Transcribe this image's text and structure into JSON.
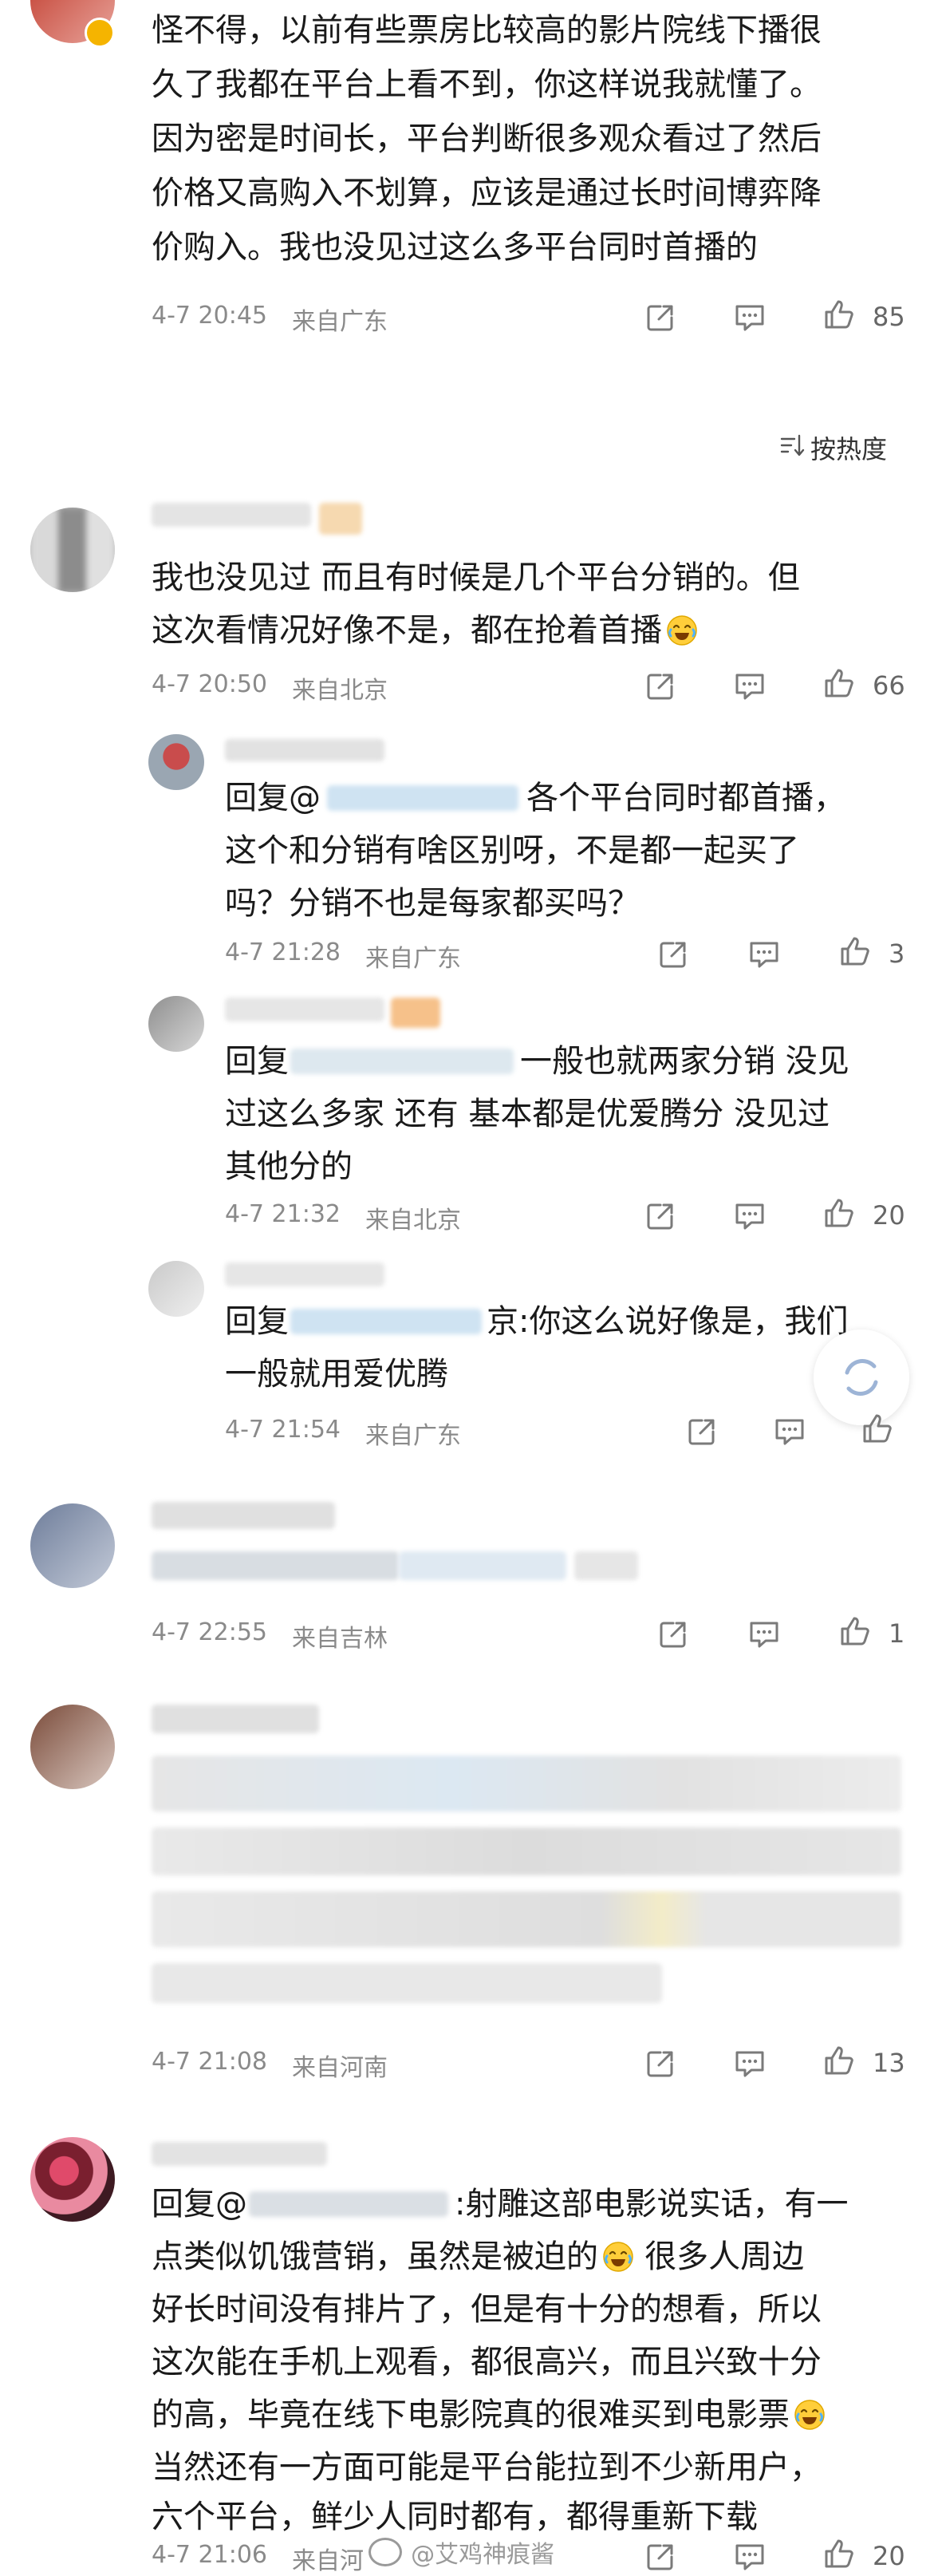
{
  "sort": {
    "label": "按热度"
  },
  "comments": [
    {
      "lines": [
        "怪不得，以前有些票房比较高的影片院线下播很",
        "久了我都在平台上看不到，你这样说我就懂了。",
        "因为密是时间长，平台判断很多观众看过了然后",
        "价格又高购入不划算，应该是通过长时间博弈降",
        "价购入。我也没见过这么多平台同时首播的"
      ],
      "time": "4-7 20:45",
      "location": "来自广东",
      "likes": "85"
    },
    {
      "lines": [
        "我也没见过 而且有时候是几个平台分销的。但",
        "这次看情况好像不是，都在抢着首播"
      ],
      "time": "4-7 20:50",
      "location": "来自北京",
      "likes": "66"
    },
    {
      "lines": [
        "回复@",
        "各个平台同时都首播，",
        "这个和分销有啥区别呀，不是都一起买了",
        "吗？分销不也是每家都买吗？"
      ],
      "time": "4-7 21:28",
      "location": "来自广东",
      "likes": "3"
    },
    {
      "lines": [
        "回复",
        "一般也就两家分销 没见",
        "过这么多家 还有 基本都是优爱腾分 没见过",
        "其他分的"
      ],
      "time": "4-7 21:32",
      "location": "来自北京",
      "likes": "20"
    },
    {
      "lines": [
        "回复",
        "京:你这么说好像是，我们",
        "一般就用爱优腾"
      ],
      "time": "4-7 21:54",
      "location": "来自广东",
      "likes": ""
    },
    {
      "lines": [],
      "time": "4-7 22:55",
      "location": "来自吉林",
      "likes": "1"
    },
    {
      "lines": [],
      "time": "4-7 21:08",
      "location": "来自河南",
      "likes": "13"
    },
    {
      "lines": [
        "回复@",
        ":射雕这部电影说实话，有一",
        "点类似饥饿营销，虽然是被迫的",
        "很多人周边",
        "好长时间没有排片了，但是有十分的想看，所以",
        "这次能在手机上观看，都很高兴，而且兴致十分",
        "的高，毕竟在线下电影院真的很难买到电影票",
        "当然还有一方面可能是平台能拉到不少新用户，",
        "六个平台，鲜少人同时都有，都得重新下载"
      ],
      "time": "4-7 21:06",
      "location": "来自河",
      "likes": "20"
    }
  ],
  "watermark": "@艾鸡神痕酱",
  "icons": {
    "share": "share-icon",
    "comment": "comment-icon",
    "like": "thumb-up-icon",
    "sort": "sort-icon",
    "emoji": "laugh-cry-emoji-icon"
  },
  "colors": {
    "text": "#1a1a1a",
    "meta": "#8a8a8a",
    "icon": "#7a7a7a",
    "blur_blue": "#cfe3f2"
  }
}
